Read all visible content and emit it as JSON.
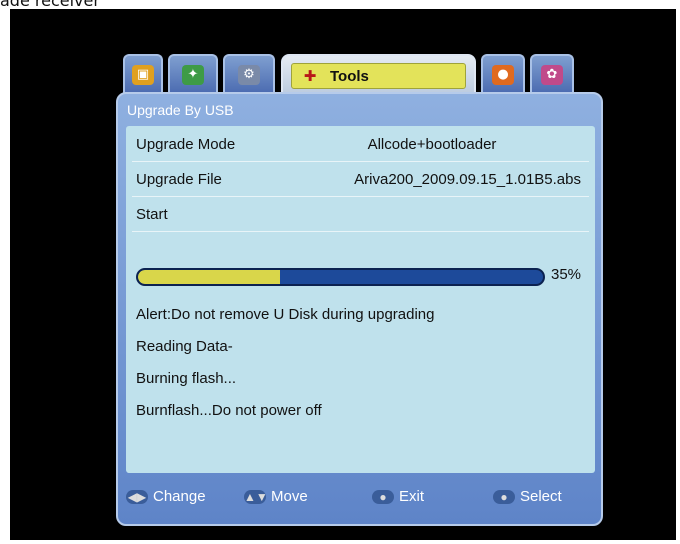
{
  "caption": "ade receiver",
  "tabs": [
    {
      "icon": "tv-icon"
    },
    {
      "icon": "satellite-dish-icon"
    },
    {
      "icon": "tools-wrench-icon"
    },
    {
      "icon": "tools-icon",
      "label": "Tools",
      "active": true
    },
    {
      "icon": "globe-icon"
    },
    {
      "icon": "game-icon"
    }
  ],
  "panel": {
    "title": "Upgrade By USB",
    "rows": [
      {
        "label": "Upgrade Mode",
        "value": "Allcode+bootloader"
      },
      {
        "label": "Upgrade File",
        "value": "Ariva200_2009.09.15_1.01B5.abs"
      },
      {
        "label": "Start",
        "value": ""
      }
    ],
    "progress": {
      "value": 0.35,
      "label": "35%"
    },
    "messages": [
      "Alert:Do not remove U Disk during upgrading",
      "Reading Data-",
      "Burning flash...",
      "Burnflash...Do not power off"
    ]
  },
  "footer": [
    {
      "icon": "left-right-arrows-icon",
      "label": "Change"
    },
    {
      "icon": "up-down-arrows-icon",
      "label": "Move"
    },
    {
      "icon": "exit-key-icon",
      "label": "Exit"
    },
    {
      "icon": "ok-key-icon",
      "label": "Select"
    }
  ],
  "colors": {
    "active_tab": "#e3e35a",
    "content_bg": "#bfe1ec",
    "progress_fill": "#d9d64a",
    "progress_track": "#1d4a9a"
  }
}
